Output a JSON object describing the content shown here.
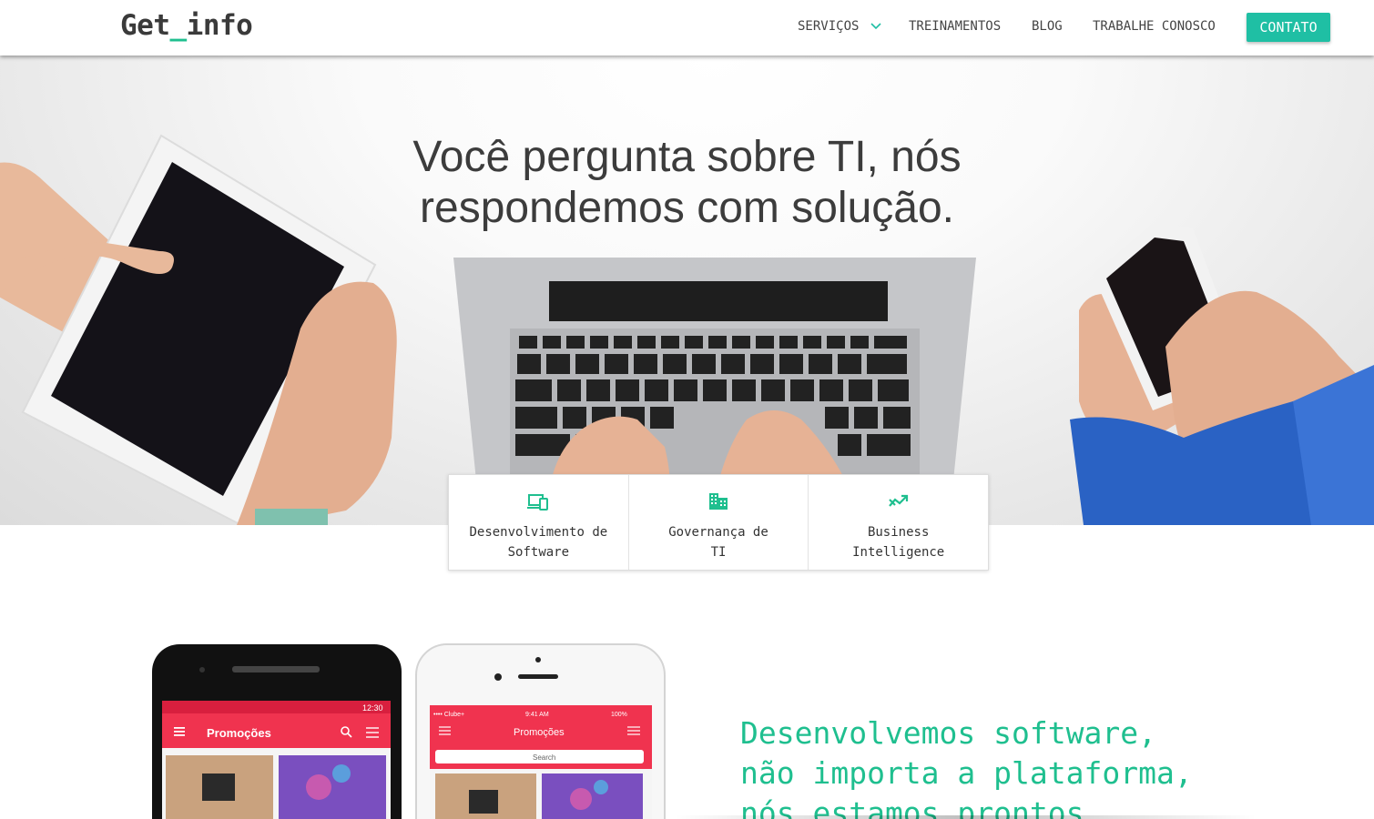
{
  "navbar": {
    "logo_main": "Get",
    "logo_underscore": "_",
    "logo_suffix": "info",
    "items": [
      {
        "label": "SERVIÇOS"
      },
      {
        "label": "TREINAMENTOS"
      },
      {
        "label": "BLOG"
      },
      {
        "label": "TRABALHE CONOSCO"
      }
    ],
    "cta_label": "CONTATO"
  },
  "hero": {
    "title_line1": "Você pergunta sobre TI, nós",
    "title_line2": "respondemos com solução."
  },
  "services": [
    {
      "icon": "devices-icon",
      "line1": "Desenvolvimento de",
      "line2": "Software"
    },
    {
      "icon": "building-icon",
      "line1": "Governança de",
      "line2": "TI"
    },
    {
      "icon": "trending-icon",
      "line1": "Business",
      "line2": "Intelligence"
    }
  ],
  "section_dev": {
    "heading_line1": "Desenvolvemos software,",
    "heading_line2": "não importa a plataforma,",
    "heading_line3": "nós estamos prontos",
    "android_app_title": "Promoções",
    "android_time": "12:30",
    "ios_carrier": "•••• Clube+",
    "ios_time": "9:41 AM",
    "ios_battery": "100%",
    "ios_app_title": "Promoções",
    "ios_search_placeholder": "Search"
  },
  "colors": {
    "accent": "#1fbf8f",
    "cta": "#1fbfa4",
    "app_red": "#f0334f"
  }
}
